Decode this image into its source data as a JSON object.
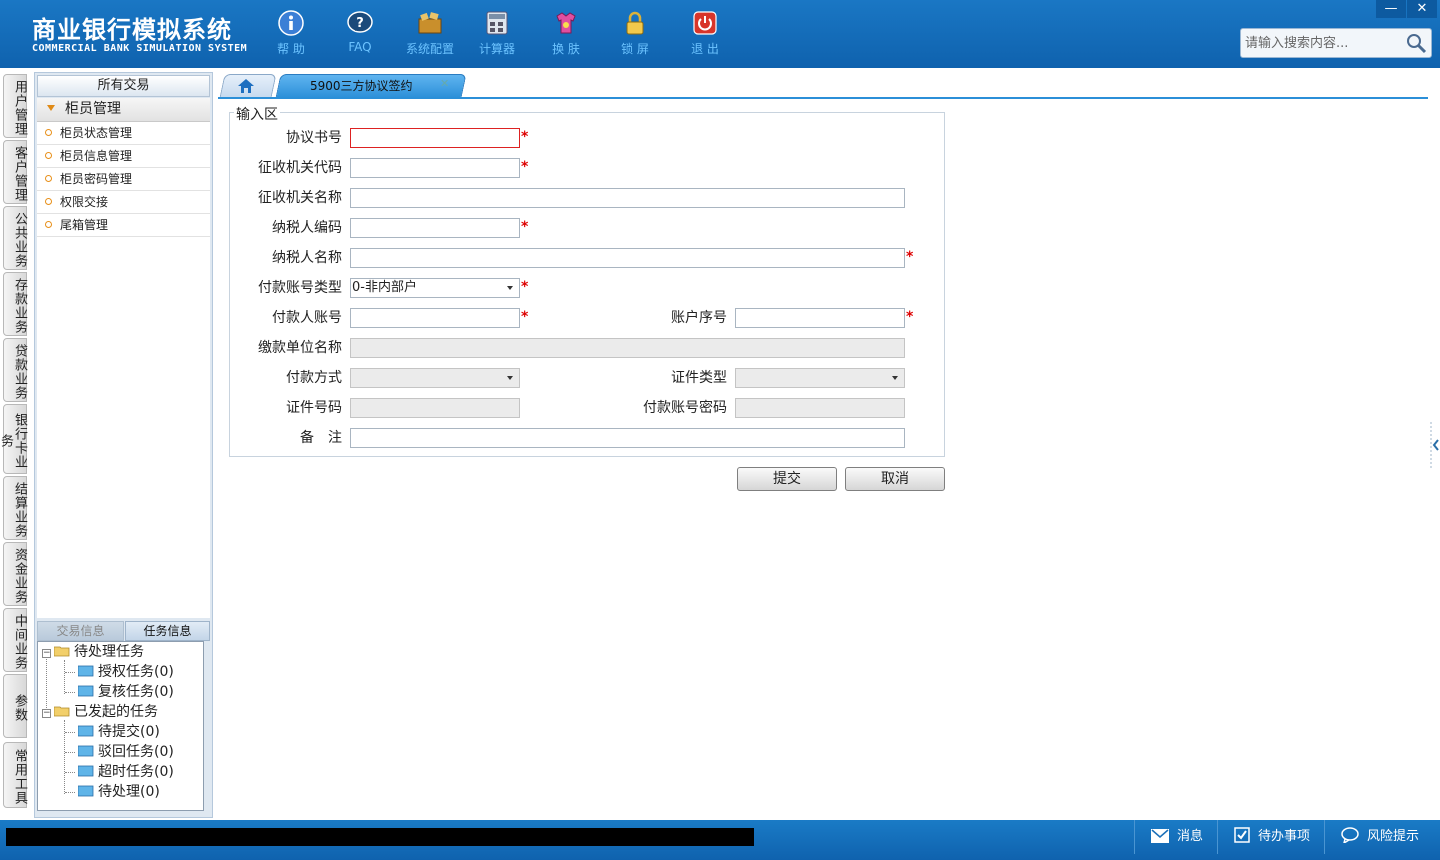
{
  "header": {
    "title_cn": "商业银行模拟系统",
    "title_en": "COMMERCIAL BANK SIMULATION SYSTEM",
    "toolbar": [
      {
        "label": "帮 助",
        "icon": "help-icon"
      },
      {
        "label": "FAQ",
        "icon": "faq-icon"
      },
      {
        "label": "系统配置",
        "icon": "system-config-icon"
      },
      {
        "label": "计算器",
        "icon": "calculator-icon"
      },
      {
        "label": "换 肤",
        "icon": "skin-icon"
      },
      {
        "label": "锁 屏",
        "icon": "lock-icon"
      },
      {
        "label": "退 出",
        "icon": "power-icon"
      }
    ],
    "minimize": "—",
    "close": "✕",
    "search_placeholder": "请输入搜索内容..."
  },
  "vtabs": [
    "用户管理",
    "客户管理",
    "公共业务",
    "存款业务",
    "贷款业务",
    "银行卡业务",
    "结算业务",
    "资金业务",
    "中间业务",
    "参数",
    "常用工具"
  ],
  "left_panel": {
    "header": "所有交易",
    "group": "柜员管理",
    "items": [
      "柜员状态管理",
      "柜员信息管理",
      "柜员密码管理",
      "权限交接",
      "尾箱管理"
    ],
    "info_tabs": [
      "交易信息",
      "任务信息"
    ],
    "tree": {
      "pending": "待处理任务",
      "pending_children": [
        "授权任务(0)",
        "复核任务(0)"
      ],
      "initiated": "已发起的任务",
      "initiated_children": [
        "待提交(0)",
        "驳回任务(0)",
        "超时任务(0)",
        "待处理(0)"
      ]
    }
  },
  "tabs": {
    "active": "5900三方协议签约",
    "close": "✕"
  },
  "form": {
    "legend": "输入区",
    "labels": {
      "agreement_no": "协议书号",
      "collector_code": "征收机关代码",
      "collector_name": "征收机关名称",
      "taxpayer_code": "纳税人编码",
      "taxpayer_name": "纳税人名称",
      "account_type": "付款账号类型",
      "payer_account": "付款人账号",
      "account_seq": "账户序号",
      "payer_unit_name": "缴款单位名称",
      "payment_method": "付款方式",
      "id_type": "证件类型",
      "id_number": "证件号码",
      "account_password": "付款账号密码",
      "remarks": "备　注"
    },
    "values": {
      "account_type": "0-非内部户"
    },
    "required_mark": "*",
    "submit": "提交",
    "cancel": "取消"
  },
  "statusbar": {
    "messages": "消息",
    "todo": "待办事项",
    "risk": "风险提示"
  }
}
